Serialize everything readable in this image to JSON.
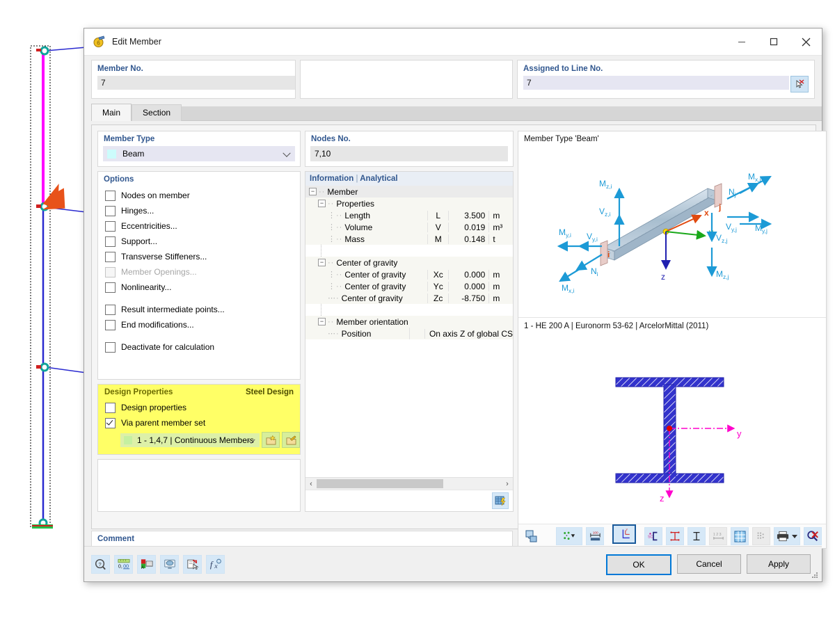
{
  "window": {
    "title": "Edit Member",
    "icon": "member-icon",
    "minimize": "minimize-icon",
    "maximize": "maximize-icon",
    "close": "close-icon"
  },
  "top": {
    "member_no_label": "Member No.",
    "member_no_value": "7",
    "assigned_line_label": "Assigned to Line No.",
    "assigned_line_value": "7",
    "pick_icon": "pick-line-icon"
  },
  "tabs": [
    {
      "label": "Main",
      "active": true
    },
    {
      "label": "Section",
      "active": false
    }
  ],
  "member_type": {
    "title": "Member Type",
    "value": "Beam",
    "swatch": "#ccfcfc"
  },
  "options": {
    "title": "Options",
    "items": [
      {
        "label": "Nodes on member",
        "checked": false,
        "disabled": false
      },
      {
        "label": "Hinges...",
        "checked": false,
        "disabled": false
      },
      {
        "label": "Eccentricities...",
        "checked": false,
        "disabled": false
      },
      {
        "label": "Support...",
        "checked": false,
        "disabled": false
      },
      {
        "label": "Transverse Stiffeners...",
        "checked": false,
        "disabled": false
      },
      {
        "label": "Member Openings...",
        "checked": false,
        "disabled": true
      },
      {
        "label": "Nonlinearity...",
        "checked": false,
        "disabled": false
      },
      {
        "label": "Result intermediate points...",
        "checked": false,
        "disabled": false,
        "gap": true
      },
      {
        "label": "End modifications...",
        "checked": false,
        "disabled": false
      },
      {
        "label": "Deactivate for calculation",
        "checked": false,
        "disabled": false,
        "gap": true
      }
    ]
  },
  "design_properties": {
    "title": "Design Properties",
    "title_right": "Steel Design",
    "checkbox_design_properties": "Design properties",
    "checkbox_design_properties_checked": false,
    "checkbox_via_parent": "Via parent member set",
    "checkbox_via_parent_checked": true,
    "parent_set_value": "1 - 1,4,7 | Continuous Members",
    "new_set_icon": "new-member-set-icon",
    "edit_set_icon": "edit-member-set-icon",
    "background": "#ffff66"
  },
  "nodes": {
    "label": "Nodes No.",
    "value": "7,10"
  },
  "information": {
    "title": "Information",
    "title_sep": "|",
    "title_sub": "Analytical",
    "rows": [
      {
        "indent": 0,
        "expander": "-",
        "name": "Member",
        "symbol": "",
        "value": "",
        "unit": "",
        "header": true
      },
      {
        "indent": 1,
        "expander": "-",
        "name": "Properties",
        "symbol": "",
        "value": "",
        "unit": ""
      },
      {
        "indent": 2,
        "expander": "",
        "name": "Length",
        "symbol": "L",
        "value": "3.500",
        "unit": "m"
      },
      {
        "indent": 2,
        "expander": "",
        "name": "Volume",
        "symbol": "V",
        "value": "0.019",
        "unit": "m³"
      },
      {
        "indent": 2,
        "expander": "",
        "name": "Mass",
        "symbol": "M",
        "value": "0.148",
        "unit": "t"
      },
      {
        "indent": 0,
        "expander": "",
        "name": "",
        "symbol": "",
        "value": "",
        "unit": "",
        "spacer": true
      },
      {
        "indent": 1,
        "expander": "-",
        "name": "Center of gravity",
        "symbol": "",
        "value": "",
        "unit": ""
      },
      {
        "indent": 2,
        "expander": "",
        "name": "Center of gravity",
        "symbol": "Xc",
        "value": "0.000",
        "unit": "m"
      },
      {
        "indent": 2,
        "expander": "",
        "name": "Center of gravity",
        "symbol": "Yc",
        "value": "0.000",
        "unit": "m"
      },
      {
        "indent": 2,
        "expander": "",
        "name": "Center of gravity",
        "symbol": "Zc",
        "value": "-8.750",
        "unit": "m"
      },
      {
        "indent": 0,
        "expander": "",
        "name": "",
        "symbol": "",
        "value": "",
        "unit": "",
        "spacer": true
      },
      {
        "indent": 1,
        "expander": "-",
        "name": "Member orientation",
        "symbol": "",
        "value": "",
        "unit": ""
      },
      {
        "indent": 2,
        "expander": "",
        "name": "Position",
        "symbol": "",
        "value": "",
        "unit": "",
        "free": "On axis Z of global CS"
      }
    ],
    "scroll_left_icon": "scroll-left-icon",
    "scroll_right_icon": "scroll-right-icon",
    "table_button_icon": "table-grid-icon"
  },
  "graphics": {
    "member_type_caption": "Member Type 'Beam'",
    "section_caption": "1 - HE 200 A | Euronorm 53-62 | ArcelorMittal (2011)",
    "force_labels": {
      "mz_i": "M",
      "mz_i_sub": "z,i",
      "vz_i": "V",
      "vz_i_sub": "z,i",
      "my_i": "M",
      "my_i_sub": "y,i",
      "vy_i": "V",
      "vy_i_sub": "y,i",
      "n_i": "N",
      "n_i_sub": "i",
      "mx_i": "M",
      "mx_i_sub": "x,i",
      "mx_j": "M",
      "mx_j_sub": "x,j",
      "n_j": "N",
      "n_j_sub": "j",
      "vy_j": "V",
      "vy_j_sub": "y,j",
      "my_j": "M",
      "my_j_sub": "y,j",
      "vz_j": "V",
      "vz_j_sub": "z,j",
      "mz_j": "M",
      "mz_j_sub": "z,j"
    },
    "axes": {
      "x": "x",
      "y": "y",
      "z": "z",
      "i": "i",
      "j": "j"
    },
    "section_axes": {
      "y": "y",
      "z": "z"
    },
    "toolbar": [
      {
        "icon": "render-mode-icon",
        "state": "plain"
      },
      {
        "icon": "node-points-icon",
        "state": "normal",
        "caret": true
      },
      {
        "icon": "dimensions-icon",
        "state": "normal"
      },
      {
        "icon": "local-axes-icon",
        "state": "selected"
      },
      {
        "icon": "shear-center-icon",
        "state": "normal"
      },
      {
        "icon": "section-dims-horizontal-icon",
        "state": "normal"
      },
      {
        "icon": "section-dims-vertical-icon",
        "state": "normal"
      },
      {
        "icon": "numbering-icon",
        "state": "disabled"
      },
      {
        "icon": "grid-icon",
        "state": "normal"
      },
      {
        "icon": "stress-points-icon",
        "state": "disabled"
      },
      {
        "icon": "print-icon",
        "state": "normal",
        "caret": true
      },
      {
        "icon": "zoom-reset-icon",
        "state": "normal"
      }
    ]
  },
  "comment": {
    "label": "Comment",
    "value": "",
    "copy_icon": "copy-comment-icon"
  },
  "footer": {
    "tools": [
      {
        "icon": "help-icon"
      },
      {
        "icon": "units-icon"
      },
      {
        "icon": "display-properties-icon"
      },
      {
        "icon": "visual-icon"
      },
      {
        "icon": "notes-icon"
      },
      {
        "icon": "formula-icon"
      }
    ],
    "buttons": [
      {
        "label": "OK",
        "primary": true
      },
      {
        "label": "Cancel",
        "primary": false
      },
      {
        "label": "Apply",
        "primary": false
      }
    ]
  },
  "colors": {
    "accent": "#31578f",
    "highlight_yellow": "#ffff66",
    "selected_member": "#ff00ff",
    "arrow_orange": "#e8521a",
    "force_blue": "#1c9ad6",
    "section_blue": "#3333cc",
    "section_axis_magenta": "#ff00cc"
  }
}
